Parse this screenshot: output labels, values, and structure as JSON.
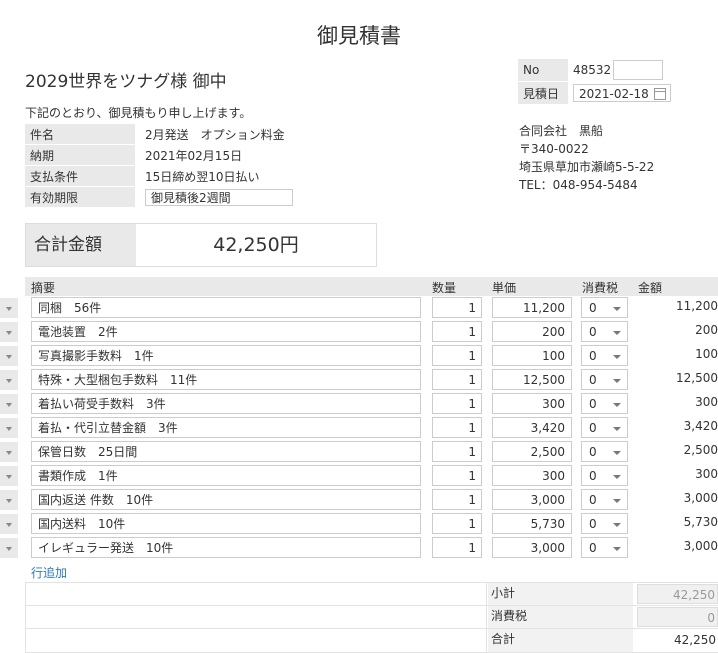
{
  "title": "御見積書",
  "customer": "2029世界をツナグ様 御中",
  "greeting": "下記のとおり、御見積もり申し上げます。",
  "info": {
    "subject_label": "件名",
    "subject": "2月発送　オプション料金",
    "due_label": "納期",
    "due": "2021年02月15日",
    "payment_label": "支払条件",
    "payment": "15日締め翌10日払い",
    "validity_label": "有効期限",
    "validity": "御見積後2週間"
  },
  "meta": {
    "no_label": "No",
    "no": "48532",
    "date_label": "見積日",
    "date": "2021-02-18"
  },
  "company": {
    "name": "合同会社　黒船",
    "postal": "〒340-0022",
    "address": "埼玉県草加市瀬崎5-5-22",
    "tel": "TEL：048-954-5484"
  },
  "total": {
    "label": "合計金額",
    "value": "42,250円"
  },
  "table": {
    "headers": {
      "desc": "摘要",
      "qty": "数量",
      "price": "単価",
      "tax": "消費税",
      "amount": "金額"
    },
    "rows": [
      {
        "desc": "同梱　56件",
        "qty": "1",
        "price": "11,200",
        "tax": "0",
        "amount": "11,200"
      },
      {
        "desc": "電池装置　2件",
        "qty": "1",
        "price": "200",
        "tax": "0",
        "amount": "200"
      },
      {
        "desc": "写真撮影手数料　1件",
        "qty": "1",
        "price": "100",
        "tax": "0",
        "amount": "100"
      },
      {
        "desc": "特殊・大型梱包手数料　11件",
        "qty": "1",
        "price": "12,500",
        "tax": "0",
        "amount": "12,500"
      },
      {
        "desc": "着払い荷受手数料　3件",
        "qty": "1",
        "price": "300",
        "tax": "0",
        "amount": "300"
      },
      {
        "desc": "着払・代引立替金額　3件",
        "qty": "1",
        "price": "3,420",
        "tax": "0",
        "amount": "3,420"
      },
      {
        "desc": "保管日数　25日間",
        "qty": "1",
        "price": "2,500",
        "tax": "0",
        "amount": "2,500"
      },
      {
        "desc": "書類作成　1件",
        "qty": "1",
        "price": "300",
        "tax": "0",
        "amount": "300"
      },
      {
        "desc": "国内返送 件数　10件",
        "qty": "1",
        "price": "3,000",
        "tax": "0",
        "amount": "3,000"
      },
      {
        "desc": "国内送料　10件",
        "qty": "1",
        "price": "5,730",
        "tax": "0",
        "amount": "5,730"
      },
      {
        "desc": "イレギュラー発送　10件",
        "qty": "1",
        "price": "3,000",
        "tax": "0",
        "amount": "3,000"
      }
    ]
  },
  "add_row": "行追加",
  "summary": {
    "subtotal_label": "小計",
    "subtotal": "42,250",
    "tax_label": "消費税",
    "tax": "0",
    "total_label": "合計",
    "total": "42,250"
  },
  "colors": {
    "label_bg": "#e9e9e9",
    "link": "#2a7ab8"
  }
}
